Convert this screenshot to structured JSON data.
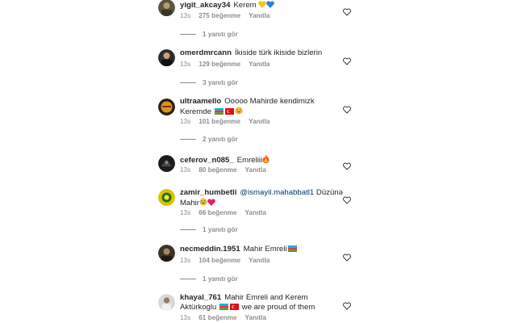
{
  "comments": [
    {
      "username": "yigit_akcay34",
      "text": "Kerem",
      "time": "13s",
      "likes": "275 beğenme",
      "reply": "Yanıtla",
      "replies": "1 yanıtı gör",
      "avatar_color": "#4b4a3a",
      "emojis": [
        "yellow-heart",
        "blue-heart"
      ]
    },
    {
      "username": "omerdmrcann",
      "text": "İkiside türk ikiside bizlerin",
      "time": "13s",
      "likes": "129 beğenme",
      "reply": "Yanıtla",
      "replies": "3 yanıtı gör",
      "avatar_color": "#2d2d2d",
      "emojis": []
    },
    {
      "username": "ultraamello",
      "text": "Ooooo Mahirde kendimizk",
      "text2": "Keremde",
      "time": "13s",
      "likes": "101 beğenme",
      "reply": "Yanıtla",
      "replies": "2 yanıtı gör",
      "avatar_color": "#c98a1f",
      "emojis": [
        "flag-azerbaijan",
        "flag-turkey",
        "face-with-tears-of-joy"
      ]
    },
    {
      "username": "ceferov_n085_",
      "text": "Emreliii",
      "time": "13s",
      "likes": "80 beğenme",
      "reply": "Yanıtla",
      "avatar_color": "#1c1c1c",
      "emojis": [
        "fire"
      ]
    },
    {
      "username": "zamir_humbetli",
      "mention": "@ismayil.mahabbatl1",
      "text": "Düzünə",
      "text2": "Mahir",
      "time": "13s",
      "likes": "66 beğenme",
      "reply": "Yanıtla",
      "replies": "1 yanıtı gör",
      "avatar_color": "#d9c400",
      "emojis": [
        "face-with-tears-of-joy",
        "red-heart"
      ]
    },
    {
      "username": "necmeddin.1951",
      "text": "Mahir Emreli",
      "time": "13s",
      "likes": "104 beğenme",
      "reply": "Yanıtla",
      "replies": "1 yanıtı gör",
      "avatar_color": "#3a3228",
      "emojis": [
        "flag-azerbaijan"
      ]
    },
    {
      "username": "khayal_761",
      "text": "Mahir Emreli and Kerem",
      "text2": "Aktürkoglu",
      "text3": "we are proud of  them",
      "time": "13s",
      "likes": "61 beğenme",
      "reply": "Yanıtla",
      "avatar_color": "#b9b9b9",
      "emojis": [
        "flag-azerbaijan",
        "flag-turkey"
      ]
    }
  ]
}
